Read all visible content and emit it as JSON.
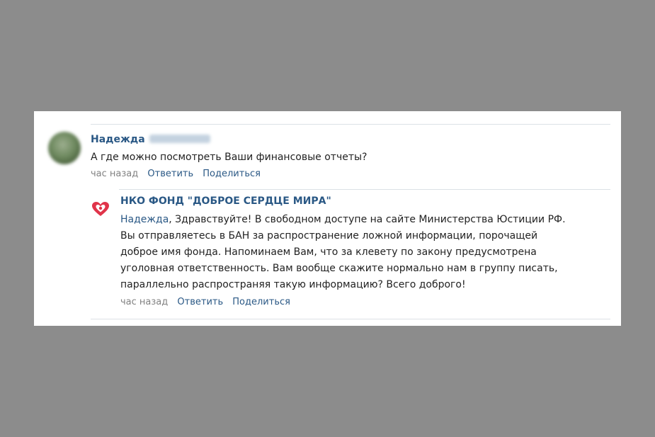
{
  "comment": {
    "author_first_name": "Надежда",
    "text": "А где можно посмотреть Ваши финансовые отчеты?",
    "time": "час назад",
    "reply_label": "Ответить",
    "share_label": "Поделиться"
  },
  "reply": {
    "author": "НКО ФОНД \"ДОБРОЕ СЕРДЦЕ МИРА\"",
    "mention": "Надежда",
    "lines": [
      ", Здравствуйте! В свободном доступе на сайте Министерства Юстиции РФ.",
      "Вы отправляетесь в БАН за распространение ложной информации, порочащей",
      "доброе имя фонда. Напоминаем Вам, что за клевету по закону предусмотрена",
      "уголовная ответственность. Вам вообще скажите нормально нам в группу писать,",
      "параллельно распространяя такую информацию? Всего доброго!"
    ],
    "time": "час назад",
    "reply_label": "Ответить",
    "share_label": "Поделиться"
  },
  "icons": {
    "commenter_avatar": "avatar",
    "org_logo": "heart-logo-icon"
  },
  "colors": {
    "link": "#2a5885",
    "meta": "#828282",
    "text": "#222222",
    "logo": "#e0344a",
    "page_bg": "#8c8c8c"
  }
}
